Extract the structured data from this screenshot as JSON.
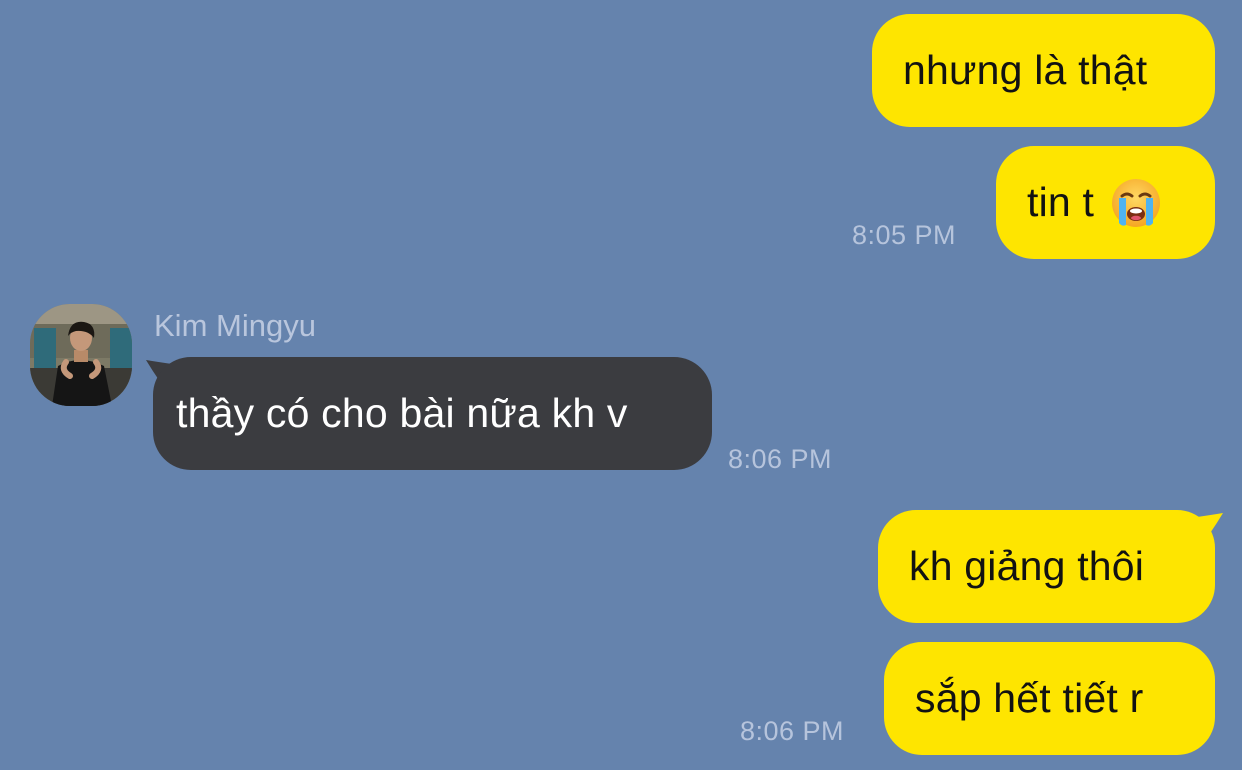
{
  "conversation": {
    "contact_name": "Kim Mingyu",
    "avatar_icon": "profile-photo-icon",
    "messages": [
      {
        "direction": "outgoing",
        "text": "nhưng là thật"
      },
      {
        "direction": "outgoing",
        "text": "tin t",
        "emoji": "loudly-crying-face-icon",
        "time": "8:05 PM"
      },
      {
        "direction": "incoming",
        "text": "thầy có cho bài nữa kh v",
        "time": "8:06 PM"
      },
      {
        "direction": "outgoing",
        "text": "kh giảng thôi"
      },
      {
        "direction": "outgoing",
        "text": "sắp hết tiết r",
        "time": "8:06 PM"
      }
    ]
  },
  "colors": {
    "background": "#6583ad",
    "outgoing_bubble": "#fee500",
    "incoming_bubble": "#3b3c40",
    "timestamp": "#b6c4dc"
  }
}
